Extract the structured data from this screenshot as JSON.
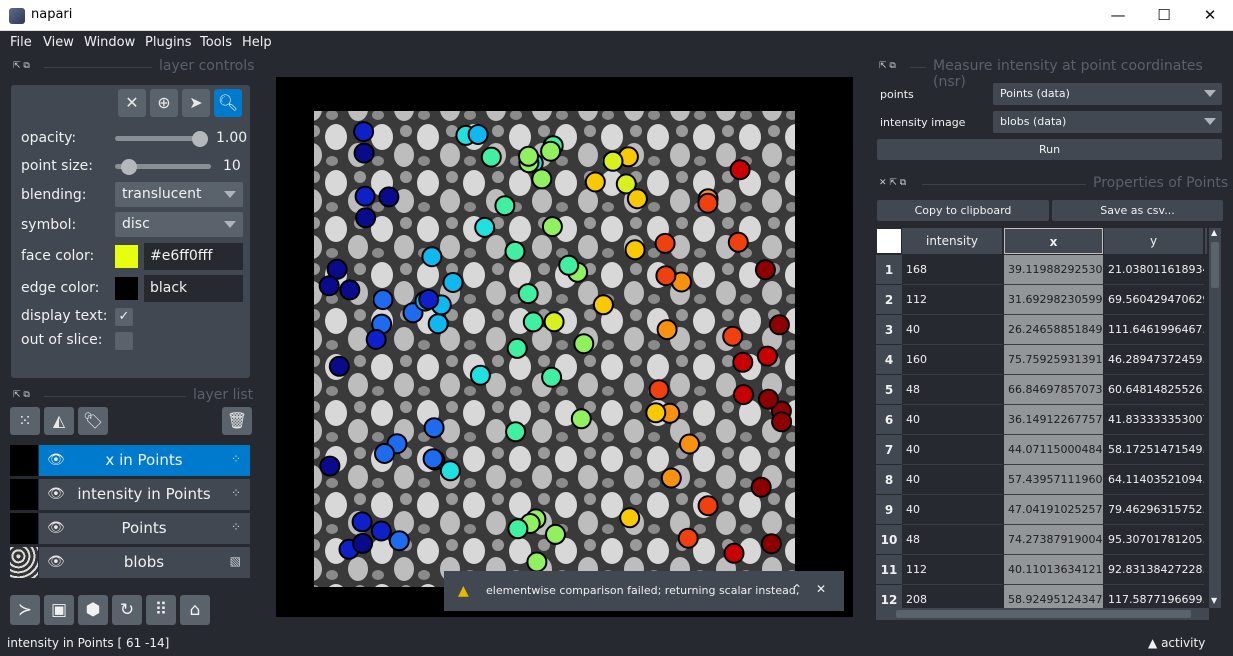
{
  "window": {
    "title": "napari",
    "minimize": "—",
    "maximize": "☐",
    "close": "✕"
  },
  "menu": [
    "File",
    "View",
    "Window",
    "Plugins",
    "Tools",
    "Help"
  ],
  "layer_controls": {
    "title": "layer controls",
    "opacity_label": "opacity:",
    "opacity_value": "1.00",
    "opacity": 1.0,
    "point_size_label": "point size:",
    "point_size_value": "10",
    "blending_label": "blending:",
    "blending_value": "translucent",
    "symbol_label": "symbol:",
    "symbol_value": "disc",
    "face_color_label": "face color:",
    "face_color_value": "#e6ff0fff",
    "face_color": "#e6ff0f",
    "edge_color_label": "edge color:",
    "edge_color_value": "black",
    "edge_color": "#000000",
    "display_text_label": "display text:",
    "out_of_slice_label": "out of slice:"
  },
  "layer_list": {
    "title": "layer list",
    "layers": [
      {
        "name": "x in Points",
        "type": "points",
        "selected": true
      },
      {
        "name": "intensity in Points",
        "type": "points",
        "selected": false
      },
      {
        "name": "Points",
        "type": "points",
        "selected": false
      },
      {
        "name": "blobs",
        "type": "image",
        "selected": false
      }
    ]
  },
  "notification": {
    "message": "elementwise comparison failed; returning scalar instead,"
  },
  "measure_widget": {
    "title": "Measure intensity at point coordinates (nsr)",
    "points_label": "points",
    "points_value": "Points (data)",
    "intensity_label": "intensity image",
    "intensity_value": "blobs (data)",
    "run_label": "Run"
  },
  "properties_widget": {
    "title": "Properties of Points",
    "copy_label": "Copy to clipboard",
    "save_label": "Save as csv...",
    "columns": [
      "intensity",
      "x",
      "y"
    ],
    "rows": [
      [
        "1",
        "168",
        "39.11988292530...",
        "21.038011618934"
      ],
      [
        "2",
        "112",
        "31.69298230599...",
        "69.5604294706294"
      ],
      [
        "3",
        "40",
        "26.24658851849...",
        "111.6461996467..."
      ],
      [
        "4",
        "160",
        "75.75925931391...",
        "46.28947372459..."
      ],
      [
        "5",
        "48",
        "66.8469785707363",
        "60.64814825526..."
      ],
      [
        "6",
        "40",
        "36.14912267757...",
        "41.8333333530079"
      ],
      [
        "7",
        "40",
        "44.07115000484...",
        "58.17251471549..."
      ],
      [
        "8",
        "40",
        "57.43957111960...",
        "64.11403521094..."
      ],
      [
        "9",
        "40",
        "47.04191025257...",
        "79.46296315752..."
      ],
      [
        "10",
        "48",
        "74.27387919004...",
        "95.30701781205..."
      ],
      [
        "11",
        "112",
        "40.11013634121...",
        "92.83138427228..."
      ],
      [
        "12",
        "208",
        "58.92495124347...",
        "117.5877196699..."
      ]
    ]
  },
  "status": {
    "text": "intensity in Points [ 61 -14]",
    "activity_label": "activity"
  }
}
